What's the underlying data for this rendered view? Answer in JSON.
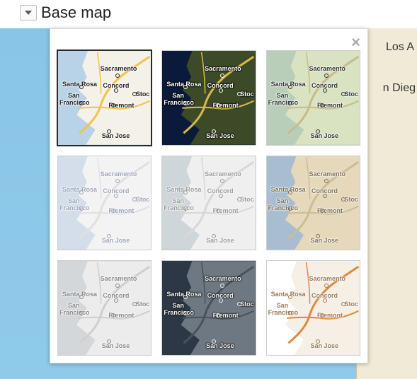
{
  "panel": {
    "title": "Base map"
  },
  "close_glyph": "×",
  "background_labels": {
    "la": "Los A",
    "sd": "n Dieg"
  },
  "city_labels": {
    "sacramento": "Sacramento",
    "santa_rosa": "Santa Rosa",
    "concord": "Concord",
    "stockton": "Stoc",
    "san": "San",
    "francisco": "Francisco",
    "fremont": "Fremont",
    "san_jose": "San Jose"
  },
  "styles": [
    {
      "id": "default",
      "selected": true,
      "water": "#b8d3e8",
      "land": "#f4f1e8",
      "road": "#f0c34a",
      "label": "#222",
      "labelHalo": "#fff"
    },
    {
      "id": "satellite",
      "selected": false,
      "water": "#0a1a3a",
      "land": "#3d4a28",
      "road": "#d8b84a",
      "label": "#fff",
      "labelHalo": "#000"
    },
    {
      "id": "terrain",
      "selected": false,
      "water": "#b9ceb8",
      "land": "#d9e2c1",
      "road": "#c8bb8a",
      "label": "#333",
      "labelHalo": "#fff"
    },
    {
      "id": "light-blue",
      "selected": false,
      "water": "#d3deea",
      "land": "#f3f3f4",
      "road": "#e0e0e0",
      "label": "#9aa5b8",
      "labelHalo": "#fff"
    },
    {
      "id": "light-gray",
      "selected": false,
      "water": "#cfd6da",
      "land": "#efefef",
      "road": "#d8d8d8",
      "label": "#9a9a9a",
      "labelHalo": "#fff"
    },
    {
      "id": "light-tan",
      "selected": false,
      "water": "#a9bdd0",
      "land": "#e6d9bb",
      "road": "#cbbd9a",
      "label": "#7d7054",
      "labelHalo": "#fff"
    },
    {
      "id": "silver",
      "selected": false,
      "water": "#d3d7d9",
      "land": "#ececec",
      "road": "#cfcfcf",
      "label": "#888",
      "labelHalo": "#fff"
    },
    {
      "id": "dark",
      "selected": false,
      "water": "#2c3845",
      "land": "#6e7882",
      "road": "#4a525a",
      "label": "#f0f0f0",
      "labelHalo": "#1a1a1a"
    },
    {
      "id": "retro",
      "selected": false,
      "water": "#ffffff",
      "land": "#f5efe6",
      "road": "#e08a3a",
      "label": "#9c7a5a",
      "labelHalo": "#fff"
    }
  ]
}
